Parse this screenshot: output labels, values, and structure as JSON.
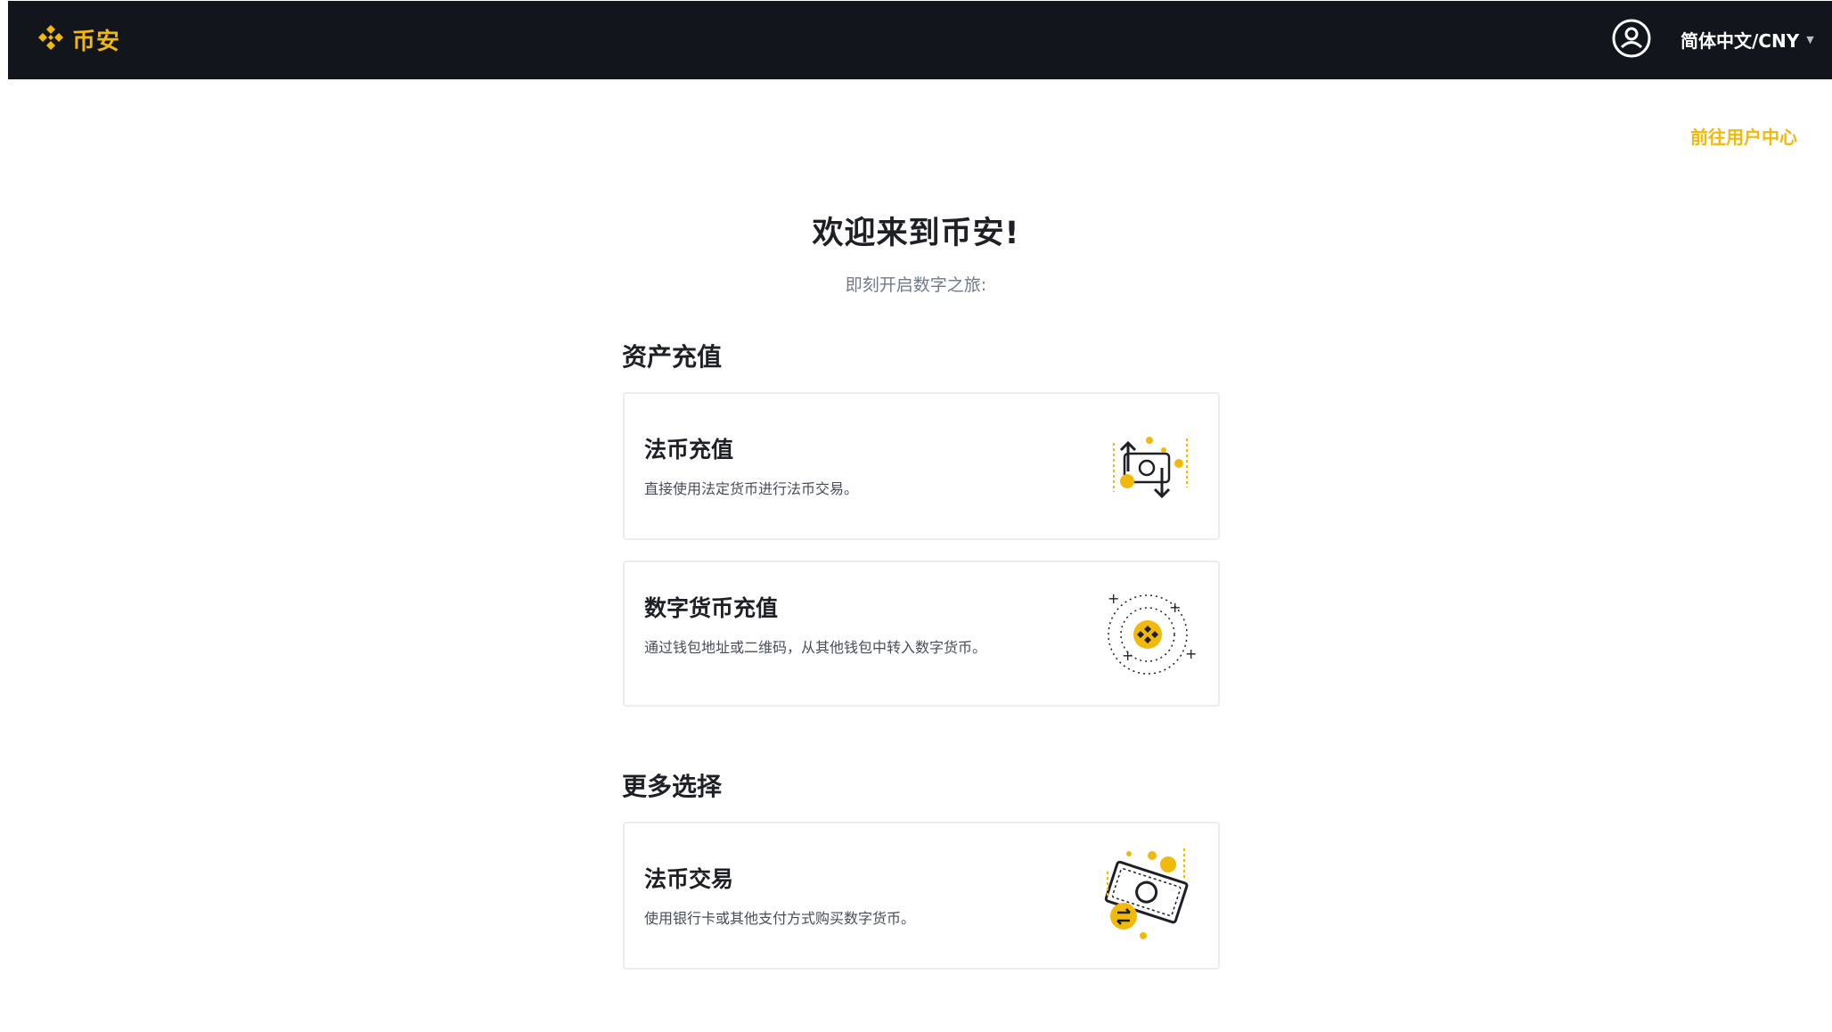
{
  "header": {
    "logo_text": "币安",
    "logo_icon": "binance-diamond-icon",
    "user_icon": "user-circle-icon",
    "language_label": "简体中文/CNY",
    "caret_icon": "caret-down-icon"
  },
  "user_center_link": "前往用户中心",
  "welcome": {
    "title": "欢迎来到币安!",
    "subtitle": "即刻开启数字之旅:"
  },
  "sections": [
    {
      "heading": "资产充值",
      "cards": [
        {
          "title": "法币充值",
          "description": "直接使用法定货币进行法币交易。",
          "icon": "fiat-deposit-icon"
        },
        {
          "title": "数字货币充值",
          "description": "通过钱包地址或二维码，从其他钱包中转入数字货币。",
          "icon": "crypto-deposit-icon"
        }
      ]
    },
    {
      "heading": "更多选择",
      "cards": [
        {
          "title": "法币交易",
          "description": "使用银行卡或其他支付方式购买数字货币。",
          "icon": "p2p-trade-icon"
        }
      ]
    }
  ],
  "colors": {
    "brand": "#f0b90b",
    "topbar": "#12161c",
    "text": "#1e2026",
    "muted": "#707a8a",
    "border": "#eaecef"
  }
}
